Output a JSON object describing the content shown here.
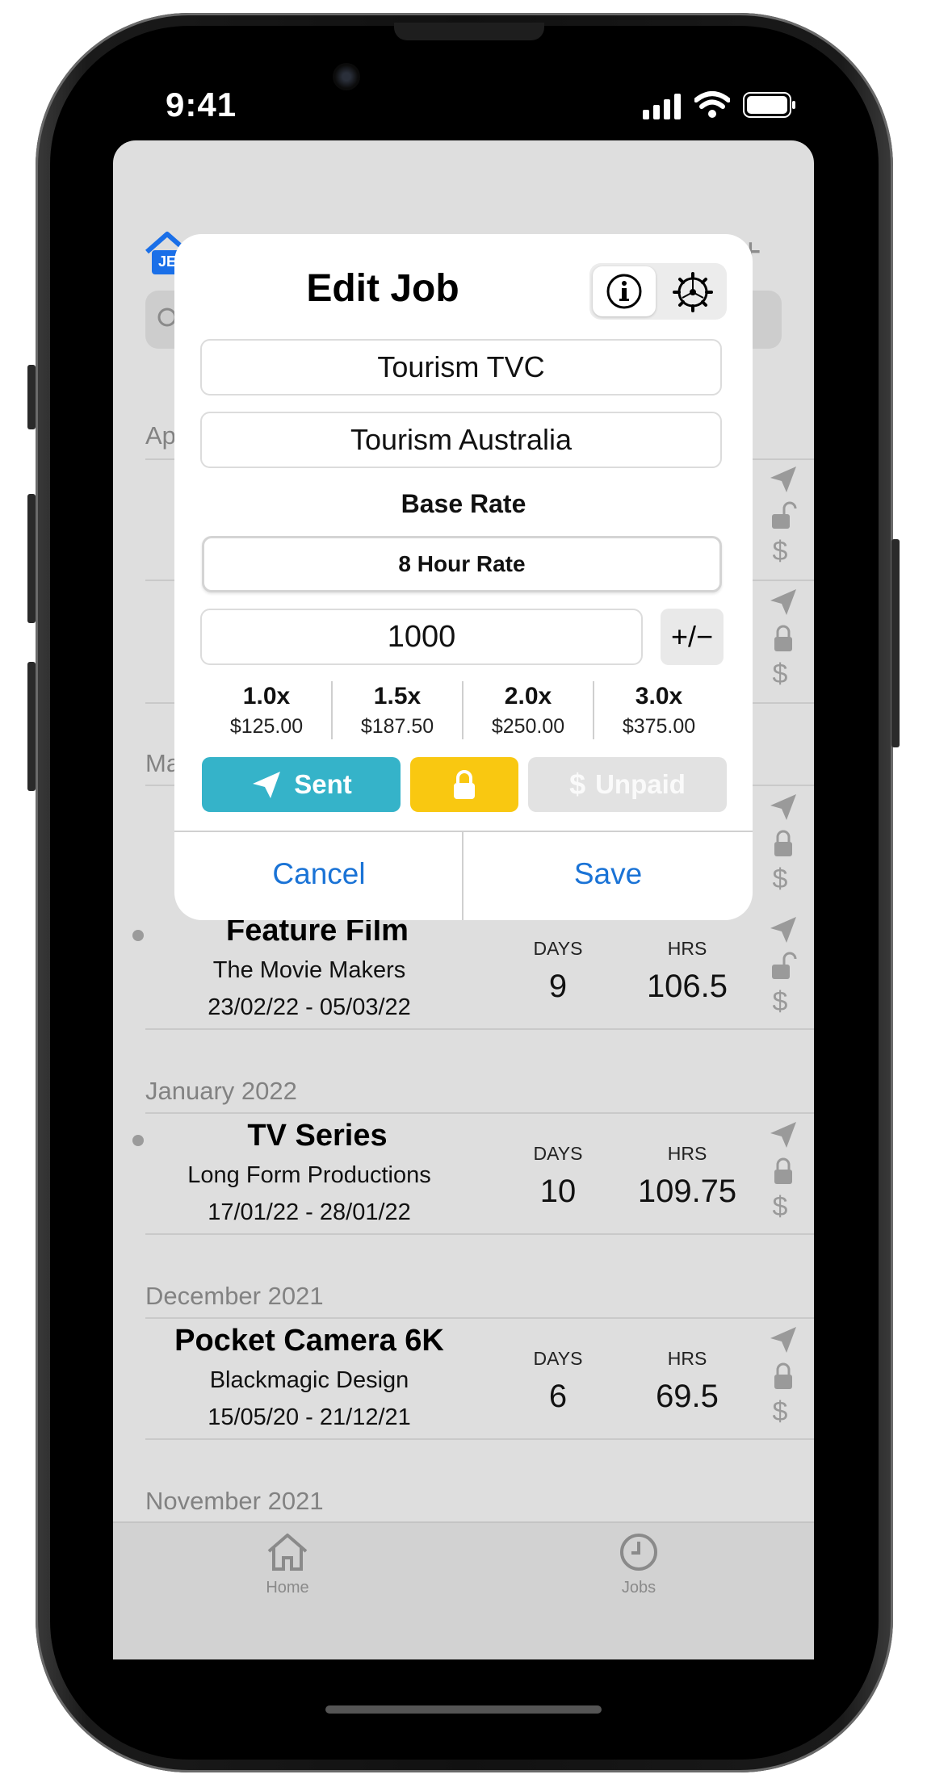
{
  "status": {
    "time": "9:41"
  },
  "background": {
    "nav_partial_label": "JE",
    "sections": {
      "apr": "Ap",
      "mar": "Ma",
      "jan": "January 2022",
      "dec": "December 2021",
      "nov": "November 2021"
    },
    "jobs": [
      {
        "title": "Feature Film",
        "company": "The Movie Makers",
        "dates": "23/02/22 - 05/03/22",
        "days_label": "DAYS",
        "days": "9",
        "hrs_label": "HRS",
        "hrs": "106.5",
        "lock": "unlocked"
      },
      {
        "title": "TV Series",
        "company": "Long Form Productions",
        "dates": "17/01/22 - 28/01/22",
        "days_label": "DAYS",
        "days": "10",
        "hrs_label": "HRS",
        "hrs": "109.75",
        "lock": "locked"
      },
      {
        "title": "Pocket Camera 6K",
        "company": "Blackmagic Design",
        "dates": "15/05/20 - 21/12/21",
        "days_label": "DAYS",
        "days": "6",
        "hrs_label": "HRS",
        "hrs": "69.5",
        "lock": "locked"
      }
    ]
  },
  "dialog": {
    "title": "Edit Job",
    "job_name": "Tourism TVC",
    "client": "Tourism Australia",
    "base_rate_heading": "Base Rate",
    "rate_type": "8 Hour Rate",
    "rate_value": "1000",
    "plusminus": "+/−",
    "multipliers": [
      {
        "x": "1.0x",
        "amount": "$125.00"
      },
      {
        "x": "1.5x",
        "amount": "$187.50"
      },
      {
        "x": "2.0x",
        "amount": "$250.00"
      },
      {
        "x": "3.0x",
        "amount": "$375.00"
      }
    ],
    "sent_label": "Sent",
    "unpaid_label": "Unpaid",
    "cancel_label": "Cancel",
    "save_label": "Save"
  },
  "tabbar": {
    "home": "Home",
    "jobs": "Jobs"
  },
  "colors": {
    "sent": "#35b3c9",
    "lock": "#f9c811",
    "unpaid": "#e2e2e2",
    "link": "#1a73d6",
    "nav_blue": "#1a6fe8"
  }
}
